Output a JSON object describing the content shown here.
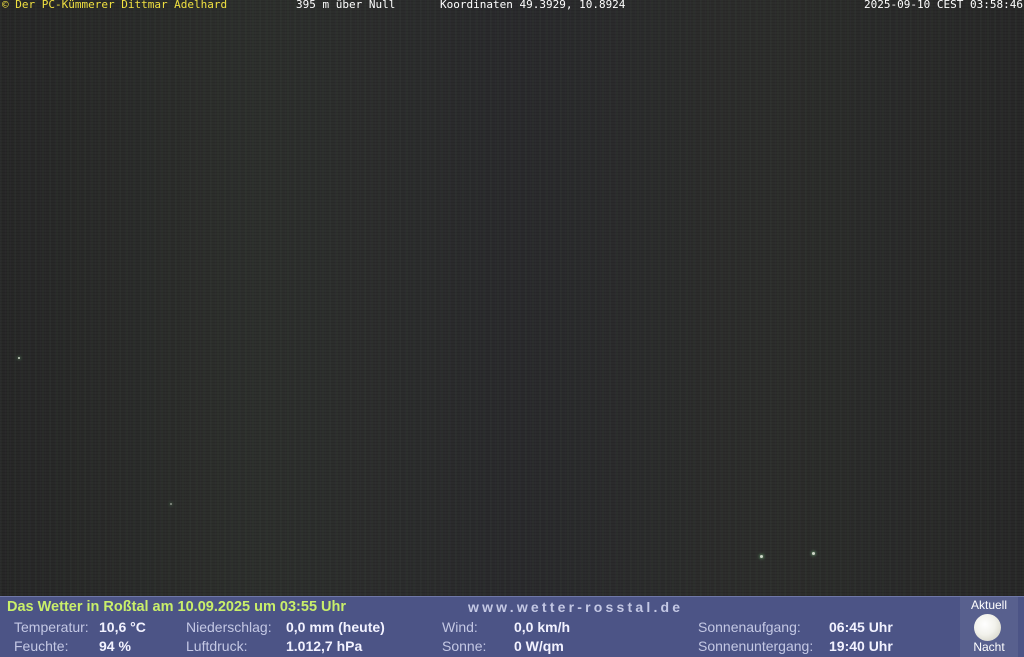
{
  "overlay": {
    "owner": "© Der PC-Kümmerer Dittmar Adelhard",
    "altitude": "395 m über Null",
    "coordinates": "Koordinaten 49.3929, 10.8924",
    "timestamp": "2025-09-10 CEST 03:58:46"
  },
  "weather": {
    "headline": "Das Wetter in Roßtal am 10.09.2025 um 03:55 Uhr",
    "website": "www.wetter-rosstal.de",
    "rows": {
      "temperature_label": "Temperatur:",
      "temperature_value": "10,6 °C",
      "humidity_label": "Feuchte:",
      "humidity_value": "94 %",
      "precipitation_label": "Niederschlag:",
      "precipitation_value": "0,0 mm (heute)",
      "pressure_label": "Luftdruck:",
      "pressure_value": "1.012,7 hPa",
      "wind_label": "Wind:",
      "wind_value": "0,0 km/h",
      "sun_label": "Sonne:",
      "sun_value": "0 W/qm",
      "sunrise_label": "Sonnenaufgang:",
      "sunrise_value": "06:45 Uhr",
      "sunset_label": "Sonnenuntergang:",
      "sunset_value": "19:40 Uhr"
    },
    "moon": {
      "caption_top": "Aktuell",
      "caption_bottom": "Nacht",
      "icon": "moon-icon"
    }
  },
  "colors": {
    "headline": "#c9ef6a",
    "panel_bg": "#4c5486",
    "owner_text": "#f0e040"
  }
}
